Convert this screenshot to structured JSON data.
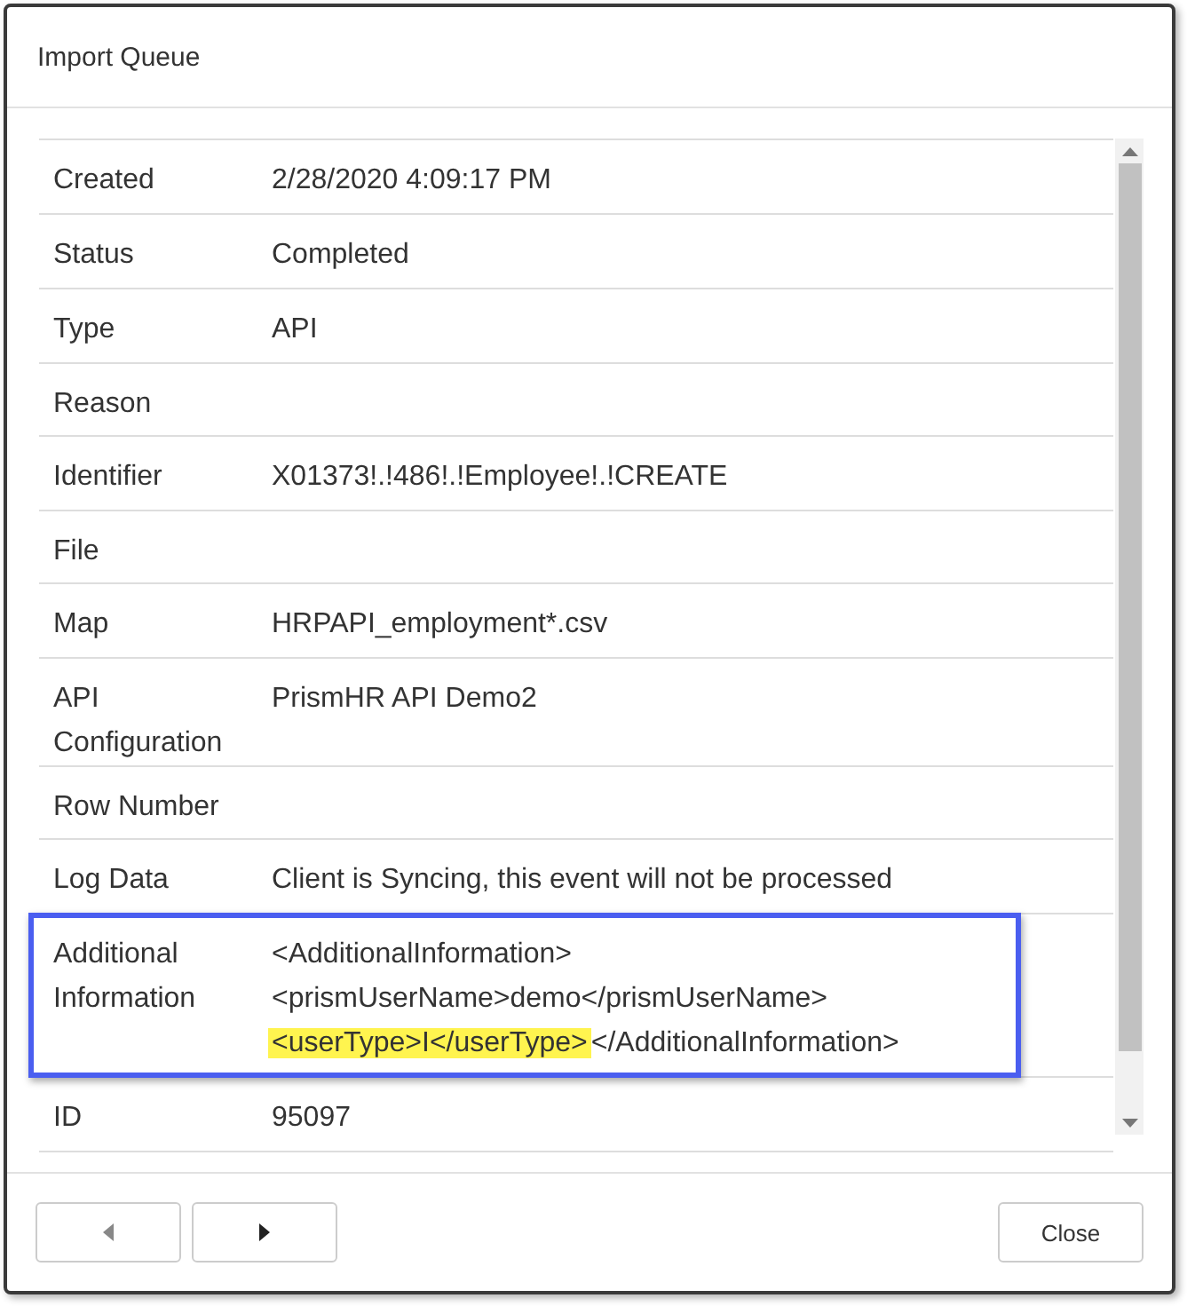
{
  "dialog": {
    "title": "Import Queue"
  },
  "rows": [
    {
      "label": "Created",
      "lines": [
        [
          {
            "text": "2/28/2020 4:09:17 PM",
            "highlighted": false
          }
        ]
      ],
      "outlined": false
    },
    {
      "label": "Status",
      "lines": [
        [
          {
            "text": "Completed",
            "highlighted": false
          }
        ]
      ],
      "outlined": false
    },
    {
      "label": "Type",
      "lines": [
        [
          {
            "text": "API",
            "highlighted": false
          }
        ]
      ],
      "outlined": false
    },
    {
      "label": "Reason",
      "lines": [],
      "outlined": false
    },
    {
      "label": "Identifier",
      "lines": [
        [
          {
            "text": "X01373!.!486!.!Employee!.!CREATE",
            "highlighted": false
          }
        ]
      ],
      "outlined": false
    },
    {
      "label": "File",
      "lines": [],
      "outlined": false
    },
    {
      "label": "Map",
      "lines": [
        [
          {
            "text": "HRPAPI_employment*.csv",
            "highlighted": false
          }
        ]
      ],
      "outlined": false
    },
    {
      "label": "API Configuration",
      "lines": [
        [
          {
            "text": "PrismHR API Demo2",
            "highlighted": false
          }
        ]
      ],
      "outlined": false
    },
    {
      "label": "Row Number",
      "lines": [],
      "outlined": false
    },
    {
      "label": "Log Data",
      "lines": [
        [
          {
            "text": "Client is Syncing, this event will not be processed",
            "highlighted": false
          }
        ]
      ],
      "outlined": false
    },
    {
      "label": "Additional Information",
      "lines": [
        [
          {
            "text": "<AdditionalInformation>",
            "highlighted": false
          }
        ],
        [
          {
            "text": "<prismUserName>demo</prismUserName>",
            "highlighted": false
          }
        ],
        [
          {
            "text": "<userType>I</userType>",
            "highlighted": true
          },
          {
            "text": "</AdditionalInformation>",
            "highlighted": false
          }
        ]
      ],
      "outlined": true
    },
    {
      "label": "ID",
      "lines": [
        [
          {
            "text": "95097",
            "highlighted": false
          }
        ]
      ],
      "outlined": false
    }
  ],
  "footer": {
    "close_label": "Close"
  }
}
